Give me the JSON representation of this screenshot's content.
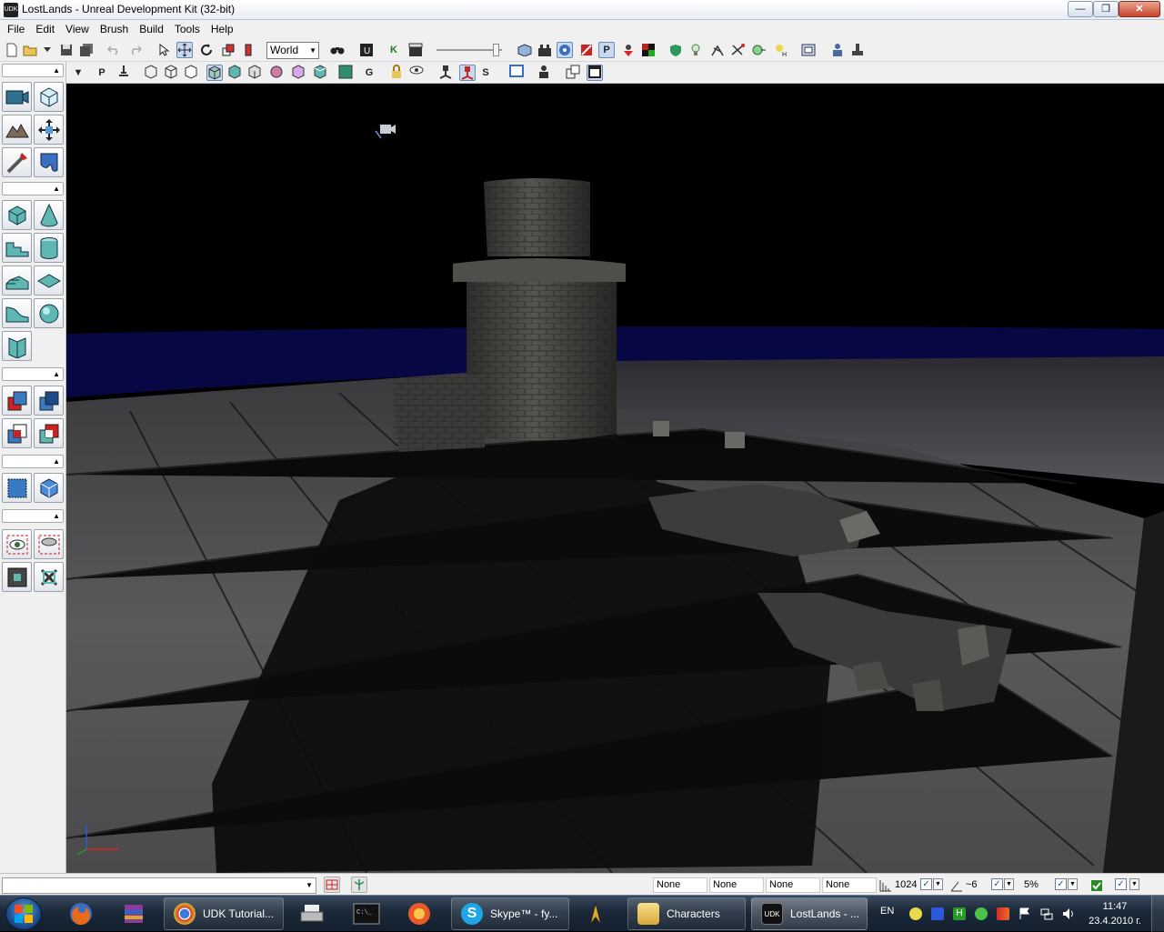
{
  "window": {
    "app_icon_text": "UDK",
    "title": "LostLands - Unreal Development Kit (32-bit)",
    "minimize_glyph": "—",
    "maximize_glyph": "❐",
    "close_glyph": "✕"
  },
  "menu": [
    "File",
    "Edit",
    "View",
    "Brush",
    "Build",
    "Tools",
    "Help"
  ],
  "toolbar": {
    "coordinate_system": "World",
    "kismet_label": "K",
    "play_label": "P"
  },
  "viewport_toolbar": {
    "perspective_label": "P",
    "game_label": "G",
    "realtime_label": "S"
  },
  "statusbar": {
    "fields": [
      "None",
      "None",
      "None",
      "None"
    ],
    "grid_size": "1024",
    "rotation_snap": "~6",
    "scale_snap": "5%"
  },
  "taskbar": {
    "tasks": [
      {
        "label": "UDK Tutorial...",
        "icon": "chrome-icon"
      },
      {
        "label": "Skype™ - fy...",
        "icon": "skype-icon"
      },
      {
        "label": "Characters",
        "icon": "folder-icon"
      },
      {
        "label": "LostLands - ...",
        "icon": "udk-icon"
      }
    ],
    "language": "EN",
    "time": "11:47",
    "date": "23.4.2010 г."
  },
  "colors": {
    "accent": "#1c4f92",
    "close_button": "#c7442a",
    "pressed_button": "#c8d8ee",
    "viewport_sky": "#000000",
    "horizon_grid": "#1a1aa0"
  }
}
